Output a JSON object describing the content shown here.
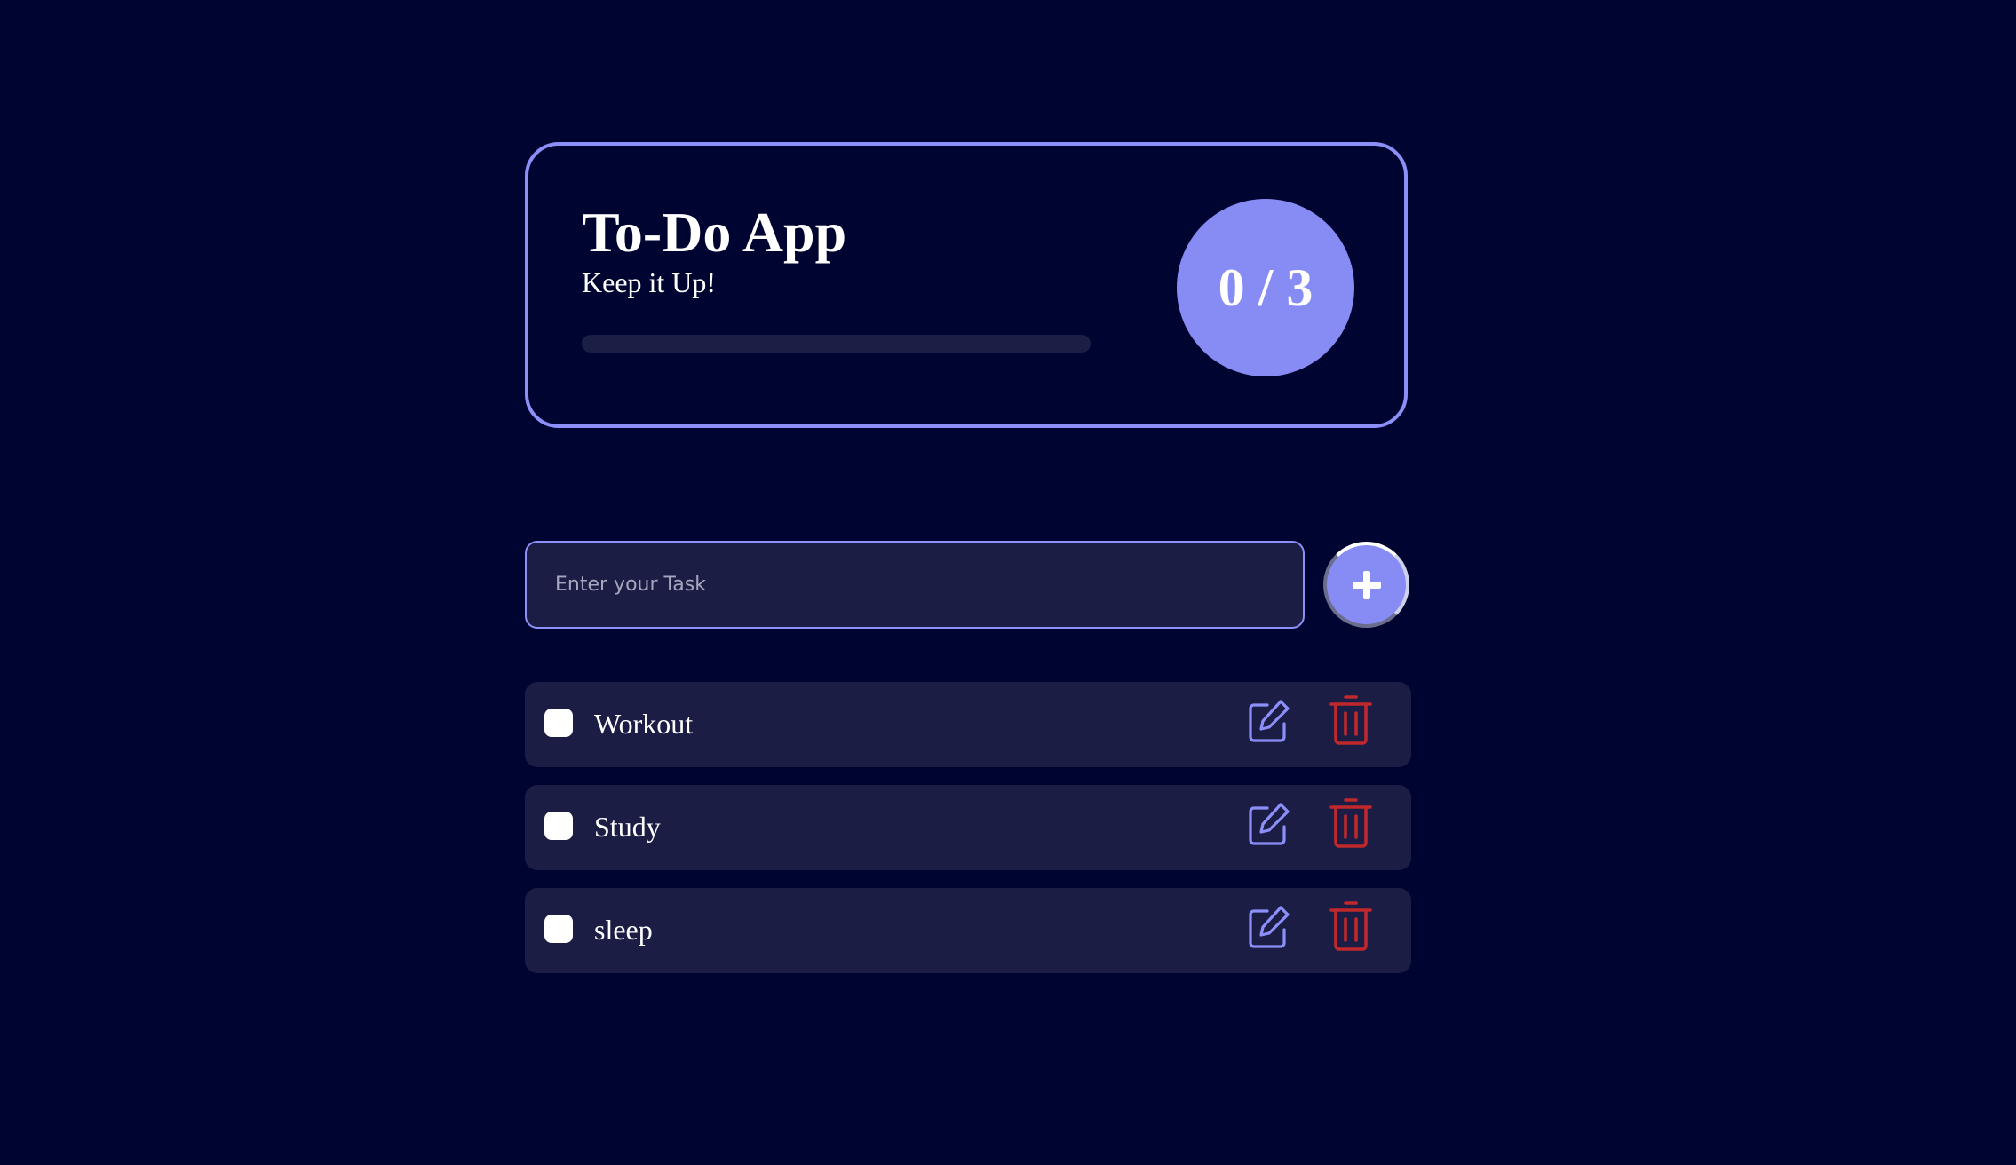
{
  "header": {
    "title": "To-Do App",
    "subtitle": "Keep it Up!",
    "progress": {
      "completed": 0,
      "total": 3,
      "fraction": 0
    },
    "counter_text": "0 / 3"
  },
  "form": {
    "input_placeholder": "Enter your Task",
    "input_value": "",
    "add_icon": "plus-icon"
  },
  "tasks": [
    {
      "label": "Workout",
      "checked": false
    },
    {
      "label": "Study",
      "checked": false
    },
    {
      "label": "sleep",
      "checked": false
    }
  ],
  "icons": {
    "edit": "edit-icon",
    "delete": "trash-icon"
  },
  "colors": {
    "background": "#000430",
    "accent": "#8b8ff7",
    "card": "#1b1d45",
    "delete": "#c0282c",
    "text": "#ffffff"
  }
}
